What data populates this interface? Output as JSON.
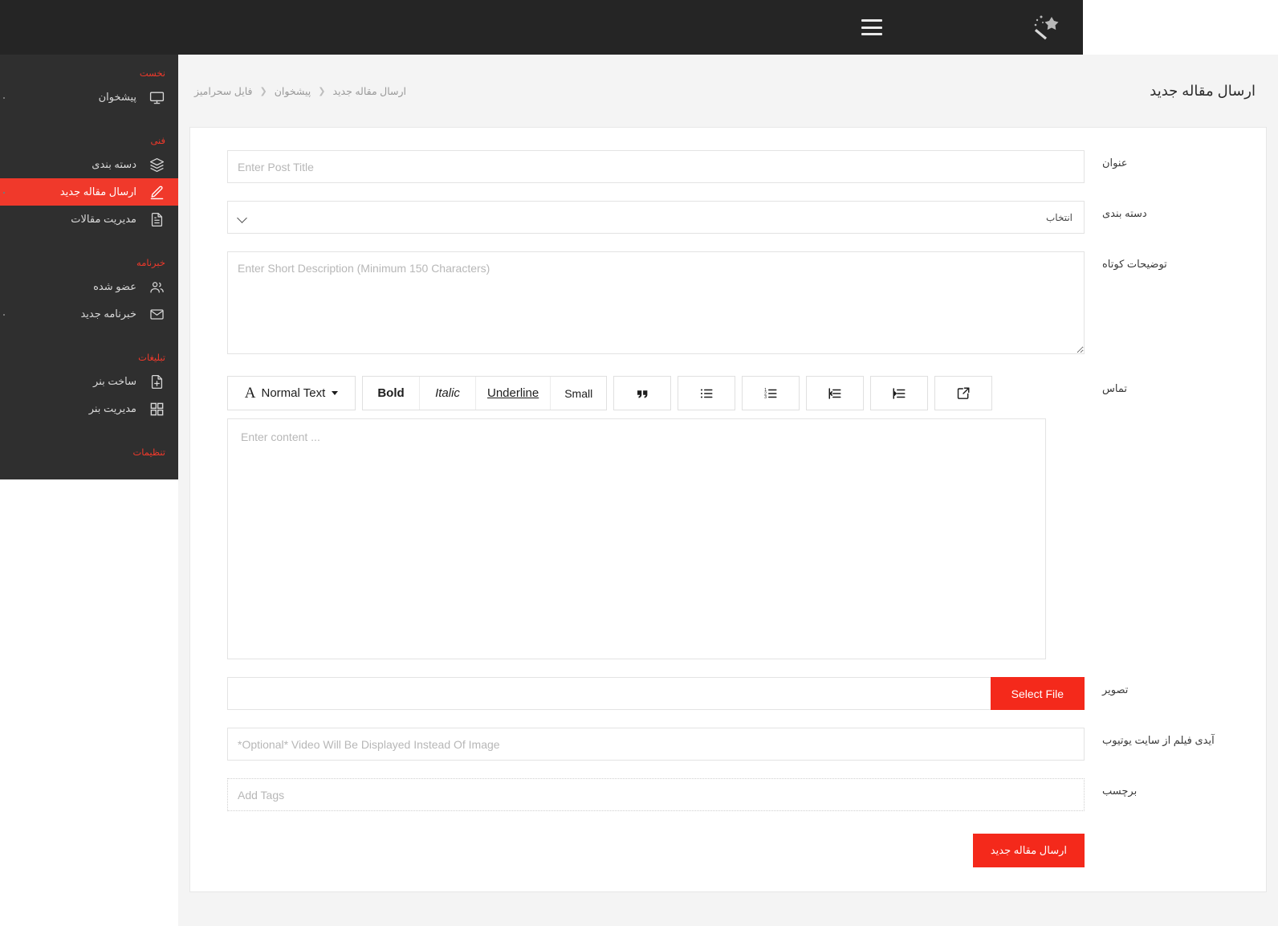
{
  "brand": {
    "logo_icon": "magic-wand-icon"
  },
  "topbar": {
    "menu_icon": "hamburger-menu-icon"
  },
  "colors": {
    "accent": "#f4291b",
    "sidebar_bg": "#2f2f2f",
    "topbar_bg": "#252525",
    "section_header": "#f0392b"
  },
  "sidebar": {
    "sections": [
      {
        "header": "نخست",
        "items": [
          {
            "label": "پیشخوان",
            "icon": "dashboard-monitor-icon",
            "active": false
          }
        ]
      },
      {
        "header": "فنی",
        "items": [
          {
            "label": "دسته بندی",
            "icon": "layers-icon",
            "active": false
          },
          {
            "label": "ارسال مقاله جدید",
            "icon": "pencil-edit-icon",
            "active": true
          },
          {
            "label": "مدیریت مقالات",
            "icon": "document-icon",
            "active": false
          }
        ]
      },
      {
        "header": "خبرنامه",
        "items": [
          {
            "label": "عضو شده",
            "icon": "users-icon",
            "active": false
          },
          {
            "label": "خبرنامه جدید",
            "icon": "envelope-icon",
            "active": false
          }
        ]
      },
      {
        "header": "تبلیغات",
        "items": [
          {
            "label": "ساخت بنر",
            "icon": "file-plus-icon",
            "active": false
          },
          {
            "label": "مدیریت بنر",
            "icon": "grid-squares-icon",
            "active": false
          }
        ]
      },
      {
        "header": "تنظیمات",
        "items": []
      }
    ]
  },
  "page": {
    "title": "ارسال مقاله جدید",
    "breadcrumb": [
      "ارسال مقاله جدید",
      "پیشخوان",
      "فایل سحرامیز"
    ]
  },
  "form": {
    "title": {
      "label": "عنوان",
      "value": "",
      "placeholder": "Enter Post Title"
    },
    "category": {
      "label": "دسته بندی",
      "selected": "انتخاب",
      "options": [
        "انتخاب"
      ]
    },
    "short_description": {
      "label": "توضیحات کوتاه",
      "value": "",
      "placeholder": "Enter Short Description (Minimum 150 Characters)"
    },
    "content": {
      "label": "تماس",
      "value": "",
      "placeholder": "Enter content ...",
      "toolbar": {
        "style_label": "Normal Text",
        "bold": "Bold",
        "italic": "Italic",
        "underline": "Underline",
        "small": "Small",
        "quote_icon": "blockquote-icon",
        "bullet_list_icon": "unordered-list-icon",
        "numbered_list_icon": "ordered-list-icon",
        "outdent_icon": "outdent-icon",
        "indent_icon": "indent-icon",
        "link_icon": "external-link-icon"
      }
    },
    "image": {
      "label": "تصویر",
      "value": "",
      "button": "Select File"
    },
    "video": {
      "label": "آیدی فیلم از سایت یوتیوب",
      "value": "",
      "placeholder": "*Optional* Video Will Be Displayed Instead Of Image"
    },
    "tags": {
      "label": "برچسب",
      "value": "",
      "placeholder": "Add Tags"
    },
    "submit": "ارسال مقاله جدید"
  }
}
